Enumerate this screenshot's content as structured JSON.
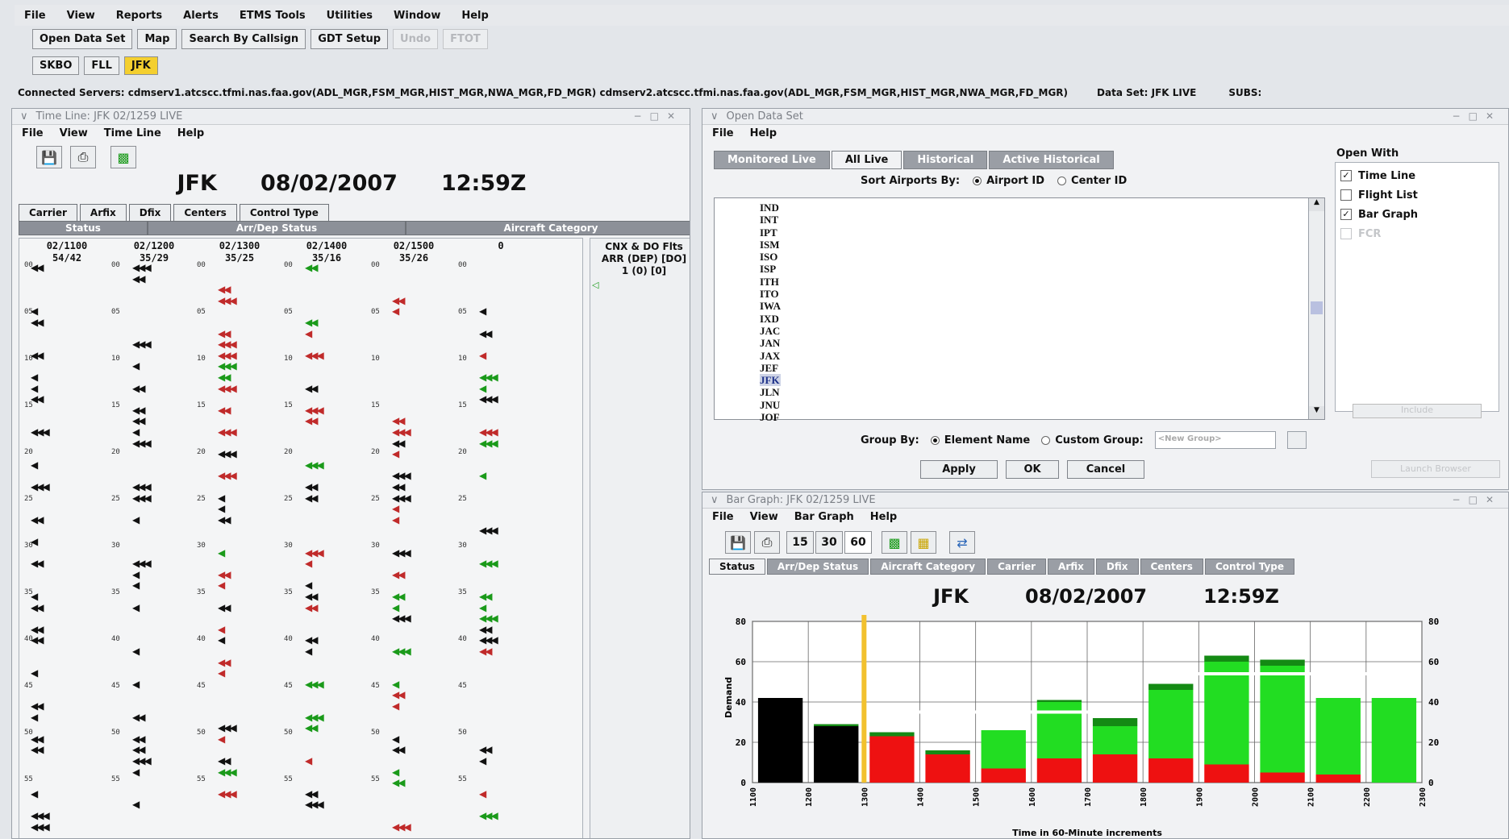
{
  "menubar": [
    "File",
    "View",
    "Reports",
    "Alerts",
    "ETMS Tools",
    "Utilities",
    "Window",
    "Help"
  ],
  "toolbar": {
    "buttons": [
      {
        "label": "Open Data Set",
        "enabled": true
      },
      {
        "label": "Map",
        "enabled": true
      },
      {
        "label": "Search By Callsign",
        "enabled": true
      },
      {
        "label": "GDT Setup",
        "enabled": true
      },
      {
        "label": "Undo",
        "enabled": false
      },
      {
        "label": "FTOT",
        "enabled": false
      }
    ],
    "airports": [
      {
        "label": "SKBO",
        "selected": false
      },
      {
        "label": "FLL",
        "selected": false
      },
      {
        "label": "JFK",
        "selected": true
      }
    ]
  },
  "status": {
    "servers": "Connected Servers: cdmserv1.atcscc.tfmi.nas.faa.gov(ADL_MGR,FSM_MGR,HIST_MGR,NWA_MGR,FD_MGR) cdmserv2.atcscc.tfmi.nas.faa.gov(ADL_MGR,FSM_MGR,HIST_MGR,NWA_MGR,FD_MGR)",
    "dataset": "Data Set: JFK LIVE",
    "subs": "SUBS:"
  },
  "timeline": {
    "title": "Time Line: JFK 02/1259 LIVE",
    "menu": [
      "File",
      "View",
      "Time Line",
      "Help"
    ],
    "airport": "JFK",
    "date": "08/02/2007",
    "time": "12:59Z",
    "tabs_row1": [
      "Carrier",
      "Arfix",
      "Dfix",
      "Centers",
      "Control Type"
    ],
    "tabs_row2": [
      "Status",
      "Arr/Dep Status",
      "Aircraft Category"
    ],
    "columns": [
      {
        "time": "02/1100",
        "counts": "54/42"
      },
      {
        "time": "02/1200",
        "counts": "35/29"
      },
      {
        "time": "02/1300",
        "counts": "35/25"
      },
      {
        "time": "02/1400",
        "counts": "35/16"
      },
      {
        "time": "02/1500",
        "counts": "35/26"
      },
      {
        "time": "0",
        "counts": ""
      }
    ],
    "side_header": [
      "CNX & DO Flts",
      "ARR (DEP) [DO]",
      "1 (0) [0]"
    ],
    "hour_ticks": [
      "00",
      "05",
      "10",
      "15",
      "20",
      "25",
      "30",
      "35",
      "40",
      "45",
      "50",
      "55"
    ]
  },
  "open_data_set": {
    "title": "Open Data Set",
    "menu": [
      "File",
      "Help"
    ],
    "tabs": [
      {
        "label": "Monitored Live",
        "selected": false
      },
      {
        "label": "All Live",
        "selected": true
      },
      {
        "label": "Historical",
        "selected": false
      },
      {
        "label": "Active Historical",
        "selected": false
      }
    ],
    "sort_label": "Sort Airports By:",
    "sort_options": [
      {
        "label": "Airport ID",
        "selected": true
      },
      {
        "label": "Center ID",
        "selected": false
      }
    ],
    "airports": [
      "IND",
      "INT",
      "IPT",
      "ISM",
      "ISO",
      "ISP",
      "ITH",
      "ITO",
      "IWA",
      "IXD",
      "JAC",
      "JAN",
      "JAX",
      "JEF",
      "JFK",
      "JLN",
      "JNU",
      "JOF"
    ],
    "selected_airport": "JFK",
    "open_with_label": "Open With",
    "open_with": [
      {
        "label": "Time Line",
        "checked": true,
        "enabled": true
      },
      {
        "label": "Flight List",
        "checked": false,
        "enabled": true
      },
      {
        "label": "Bar Graph",
        "checked": true,
        "enabled": true
      },
      {
        "label": "FCR",
        "checked": false,
        "enabled": false
      }
    ],
    "open_with_button": "Include",
    "group_label": "Group By:",
    "group_options": [
      {
        "label": "Element Name",
        "selected": true
      },
      {
        "label": "Custom Group:",
        "selected": false
      }
    ],
    "custom_group_placeholder": "<New Group>",
    "buttons": [
      "Apply",
      "OK",
      "Cancel"
    ],
    "launch_button": "Launch Browser"
  },
  "bar_graph": {
    "title": "Bar Graph: JFK 02/1259 LIVE",
    "menu": [
      "File",
      "View",
      "Bar Graph",
      "Help"
    ],
    "intervals": [
      {
        "label": "15",
        "selected": false
      },
      {
        "label": "30",
        "selected": false
      },
      {
        "label": "60",
        "selected": true
      }
    ],
    "tabs": [
      {
        "label": "Status",
        "selected": true
      },
      {
        "label": "Arr/Dep Status",
        "selected": false
      },
      {
        "label": "Aircraft Category",
        "selected": false
      },
      {
        "label": "Carrier",
        "selected": false
      },
      {
        "label": "Arfix",
        "selected": false
      },
      {
        "label": "Dfix",
        "selected": false
      },
      {
        "label": "Centers",
        "selected": false
      },
      {
        "label": "Control Type",
        "selected": false
      }
    ],
    "airport": "JFK",
    "date": "08/02/2007",
    "time": "12:59Z"
  },
  "chart_data": {
    "type": "bar",
    "stacked": true,
    "ylabel": "Demand",
    "xlabel": "Time in 60-Minute increments",
    "ylim": [
      0,
      80
    ],
    "yticks": [
      0,
      20,
      40,
      60,
      80
    ],
    "categories": [
      "1100",
      "1200",
      "1300",
      "1400",
      "1500",
      "1600",
      "1700",
      "1800",
      "1900",
      "2000",
      "2100",
      "2200",
      "2300"
    ],
    "series": [
      {
        "color": "#000000",
        "values": [
          42,
          28,
          0,
          0,
          0,
          0,
          0,
          0,
          0,
          0,
          0,
          0,
          0
        ]
      },
      {
        "color": "#ee1111",
        "values": [
          0,
          0,
          23,
          14,
          7,
          12,
          14,
          12,
          9,
          5,
          4,
          0,
          0
        ]
      },
      {
        "color": "#22dd22",
        "values": [
          0,
          0,
          0,
          0,
          19,
          28,
          14,
          34,
          51,
          53,
          38,
          42,
          0
        ]
      },
      {
        "color": "#148a14",
        "values": [
          0,
          1,
          2,
          2,
          0,
          1,
          4,
          3,
          3,
          3,
          0,
          0,
          0
        ]
      }
    ],
    "capacity": [
      {
        "from": "1100",
        "to": "1200",
        "value": 54
      },
      {
        "from": "1200",
        "to": "1800",
        "value": 35
      },
      {
        "from": "1800",
        "to": "2300",
        "value": 54
      }
    ],
    "current_time_marker": "1300",
    "grid": true
  }
}
